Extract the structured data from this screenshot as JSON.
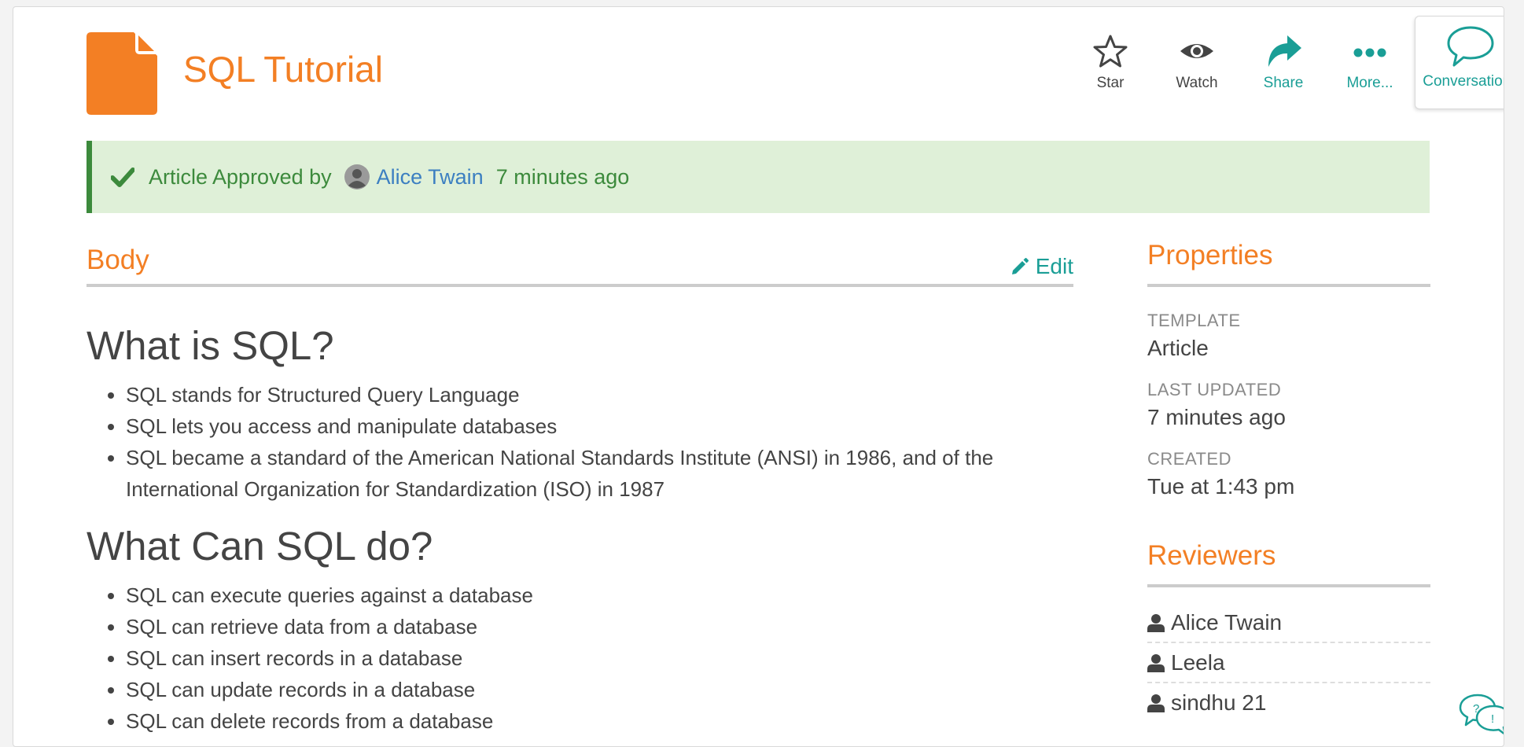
{
  "header": {
    "title": "SQL Tutorial",
    "doc_icon": "document-icon",
    "actions": [
      {
        "label": "Star",
        "icon": "star-icon"
      },
      {
        "label": "Watch",
        "icon": "eye-icon"
      },
      {
        "label": "Share",
        "icon": "share-icon"
      },
      {
        "label": "More...",
        "icon": "more-icon"
      }
    ],
    "conversations_label": "Conversations"
  },
  "banner": {
    "text": "Article Approved by",
    "approver": "Alice Twain",
    "time": "7 minutes ago"
  },
  "body": {
    "heading": "Body",
    "edit_label": "Edit",
    "sections": [
      {
        "heading": "What is SQL?",
        "items": [
          "SQL stands for Structured Query Language",
          "SQL lets you access and manipulate databases",
          "SQL became a standard of the American National Standards Institute (ANSI) in 1986, and of the International Organization for Standardization (ISO) in 1987"
        ]
      },
      {
        "heading": "What Can SQL do?",
        "items": [
          "SQL can execute queries against a database",
          "SQL can retrieve data from a database",
          "SQL can insert records in a database",
          "SQL can update records in a database",
          "SQL can delete records from a database"
        ]
      }
    ]
  },
  "properties": {
    "heading": "Properties",
    "template_label": "TEMPLATE",
    "template_value": "Article",
    "updated_label": "LAST UPDATED",
    "updated_value": "7 minutes ago",
    "created_label": "CREATED",
    "created_value": "Tue at 1:43 pm"
  },
  "reviewers": {
    "heading": "Reviewers",
    "items": [
      "Alice Twain",
      "Leela",
      "sindhu 21"
    ]
  },
  "colors": {
    "accent_orange": "#f37f24",
    "teal": "#1a9e96",
    "approved_green": "#3c8a3c",
    "approved_bg": "#dff0d8",
    "link_blue": "#3c7fc1"
  }
}
